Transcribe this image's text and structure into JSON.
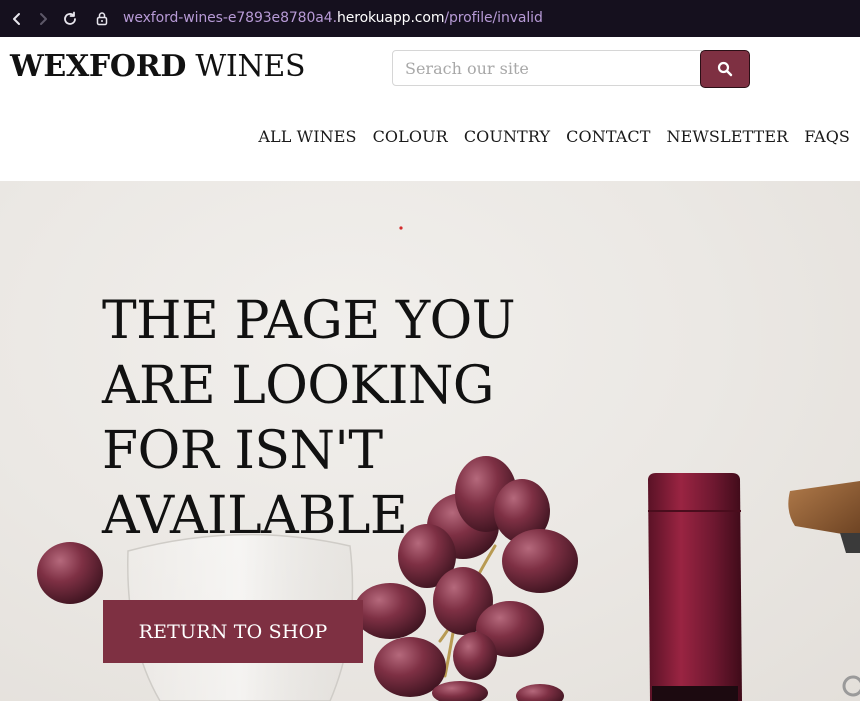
{
  "browser": {
    "url_subdomain": "wexford-wines-e7893e8780a4.",
    "url_host": "herokuapp.com",
    "url_path": "/profile/invalid"
  },
  "header": {
    "logo_bold": "WEXFORD",
    "logo_regular": " WINES",
    "search_placeholder": "Serach our site",
    "search_icon": "search-icon"
  },
  "nav": {
    "items": [
      "ALL WINES",
      "COLOUR",
      "COUNTRY",
      "CONTACT",
      "NEWSLETTER",
      "FAQS"
    ]
  },
  "hero": {
    "title": "THE PAGE YOU ARE LOOKING FOR ISN'T AVAILABLE",
    "button_label": "RETURN TO SHOP"
  },
  "colors": {
    "brand": "#7e3042",
    "browser_bar": "#15101e"
  }
}
